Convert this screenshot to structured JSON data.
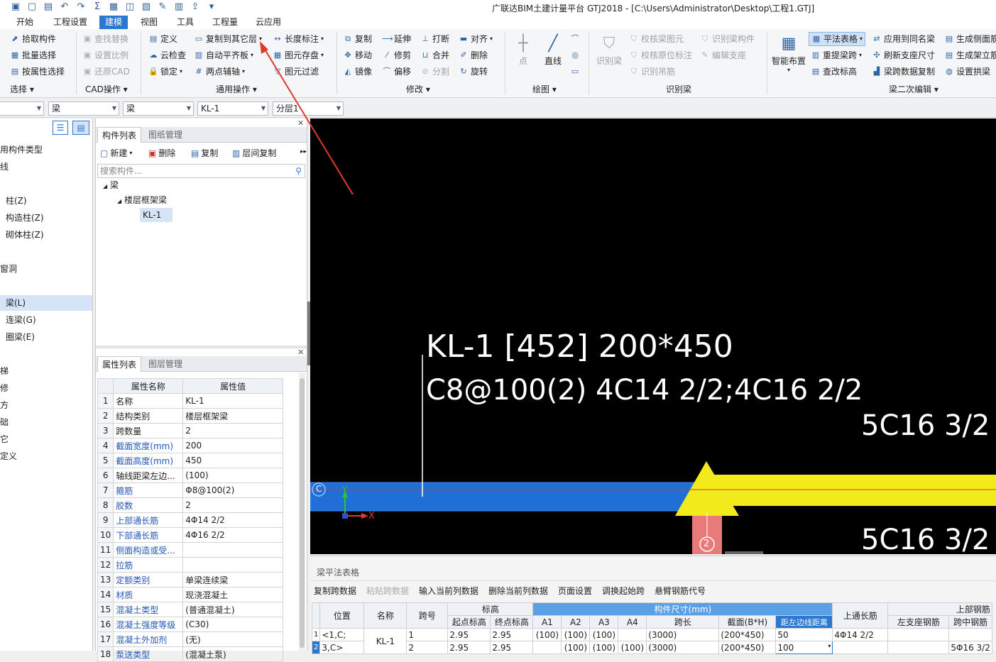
{
  "window": {
    "title": "广联达BIM土建计量平台 GTJ2018 - [C:\\Users\\Administrator\\Desktop\\工程1.GTJ]"
  },
  "menu": [
    "开始",
    "工程设置",
    "建模",
    "视图",
    "工具",
    "工程量",
    "云应用"
  ],
  "ribbon": {
    "select": {
      "items": [
        "拾取构件",
        "批量选择",
        "按属性选择"
      ],
      "group": "选择"
    },
    "cad": {
      "items": [
        "查找替换",
        "设置比例",
        "还原CAD"
      ],
      "group": "CAD操作"
    },
    "common": {
      "items": [
        "定义",
        "复制到其它层",
        "长度标注",
        "云检查",
        "自动平齐板",
        "图元存盘",
        "锁定",
        "两点辅轴",
        "图元过滤"
      ],
      "group": "通用操作"
    },
    "modify": {
      "items": [
        "复制",
        "延伸",
        "打断",
        "对齐",
        "移动",
        "修剪",
        "合并",
        "删除",
        "镜像",
        "偏移",
        "分割",
        "旋转"
      ],
      "group": "修改"
    },
    "draw": {
      "items": [
        "点",
        "直线"
      ],
      "group": "绘图"
    },
    "recognize": {
      "items": [
        "识别梁",
        "校核梁图元",
        "识别梁构件",
        "校核原位标注",
        "编辑支座",
        "识别吊筋"
      ],
      "group": "识别梁"
    },
    "beam2": {
      "items": [
        "智能布置",
        "平法表格",
        "应用到同名梁",
        "生成侧面筋",
        "重提梁跨",
        "刷新支座尺寸",
        "生成架立筋",
        "查改标高",
        "梁跨数据复制",
        "设置拱梁"
      ],
      "group": "梁二次编辑"
    }
  },
  "combos": [
    "梁",
    "梁",
    "KL-1",
    "分层1"
  ],
  "left_panel": {
    "items": [
      "用构件类型",
      "线",
      "柱(Z)",
      "构造柱(Z)",
      "砌体柱(Z)",
      "窗洞",
      "梁(L)",
      "连梁(G)",
      "圈梁(E)",
      "梯",
      "修",
      "方",
      "础",
      "它",
      "定义"
    ]
  },
  "component_list": {
    "tabs": [
      "构件列表",
      "图纸管理"
    ],
    "toolbar": [
      "新建",
      "删除",
      "复制",
      "层间复制"
    ],
    "search_placeholder": "搜索构件...",
    "tree": [
      "梁",
      "楼层框架梁",
      "KL-1"
    ]
  },
  "property_list": {
    "tabs": [
      "属性列表",
      "图层管理"
    ],
    "headers": [
      "属性名称",
      "属性值"
    ],
    "rows": [
      [
        "1",
        "名称",
        "KL-1"
      ],
      [
        "2",
        "结构类别",
        "楼层框架梁"
      ],
      [
        "3",
        "跨数量",
        "2"
      ],
      [
        "4",
        "截面宽度(mm)",
        "200"
      ],
      [
        "5",
        "截面高度(mm)",
        "450"
      ],
      [
        "6",
        "轴线距梁左边...",
        "(100)"
      ],
      [
        "7",
        "箍筋",
        "Φ8@100(2)"
      ],
      [
        "8",
        "胶数",
        "2"
      ],
      [
        "9",
        "上部通长筋",
        "4Φ14 2/2"
      ],
      [
        "10",
        "下部通长筋",
        "4Φ16 2/2"
      ],
      [
        "11",
        "侧面构造或受...",
        ""
      ],
      [
        "12",
        "拉筋",
        ""
      ],
      [
        "13",
        "定额类别",
        "单梁连续梁"
      ],
      [
        "14",
        "材质",
        "现浇混凝土"
      ],
      [
        "15",
        "混凝土类型",
        "(普通混凝土)"
      ],
      [
        "16",
        "混凝土强度等级",
        "(C30)"
      ],
      [
        "17",
        "混凝土外加剂",
        "(无)"
      ],
      [
        "18",
        "泵送类型",
        "(混凝土泵)"
      ]
    ]
  },
  "canvas": {
    "line1": "KL-1 [452] 200*450",
    "line2": "C8@100(2) 4C14 2/2;4C16 2/2",
    "top_right": "5C16 3/2",
    "bottom_right": "5C16 3/2",
    "axis_c": "C",
    "axis_2": "2",
    "x_label": "X",
    "y_label": "Y"
  },
  "beam_table": {
    "title": "梁平法表格",
    "toolbar": [
      "复制跨数据",
      "粘贴跨数据",
      "输入当前列数据",
      "删除当前列数据",
      "页面设置",
      "调换起始跨",
      "悬臂钢筋代号"
    ],
    "headers": {
      "pos": "位置",
      "name": "名称",
      "span": "跨号",
      "elev": "标高",
      "size": "构件尺寸(mm)",
      "top_long": "上通长筋",
      "top_rebar": "上部钢筋",
      "start": "起点标高",
      "end": "终点标高",
      "a1": "A1",
      "a2": "A2",
      "a3": "A3",
      "a4": "A4",
      "span_len": "跨长",
      "section": "截面(B*H)",
      "edge": "距左边线距离",
      "left_sup": "左支座钢筋",
      "mid": "跨中钢筋"
    },
    "rows": [
      {
        "idx": "1",
        "pos": "<1,C;",
        "name": "KL-1",
        "span": "1",
        "start": "2.95",
        "end": "2.95",
        "a1": "(100)",
        "a2": "(100)",
        "a3": "(100)",
        "a4": "",
        "len": "(3000)",
        "sec": "(200*450)",
        "edge": "50",
        "top": "4Φ14 2/2",
        "left": "",
        "mid": ""
      },
      {
        "idx": "2",
        "pos": "3,C>",
        "name": "",
        "span": "2",
        "start": "2.95",
        "end": "2.95",
        "a1": "",
        "a2": "(100)",
        "a3": "(100)",
        "a4": "(100)",
        "len": "(3000)",
        "sec": "(200*450)",
        "edge": "100",
        "top": "",
        "left": "",
        "mid": "5Φ16 3/2"
      }
    ]
  },
  "colors": {
    "accent": "#2b78d0",
    "beam": "#1f6fd6",
    "selected_beam": "#f2ea1a",
    "column": "#e87a7a",
    "arrow": "#e03a2a"
  }
}
